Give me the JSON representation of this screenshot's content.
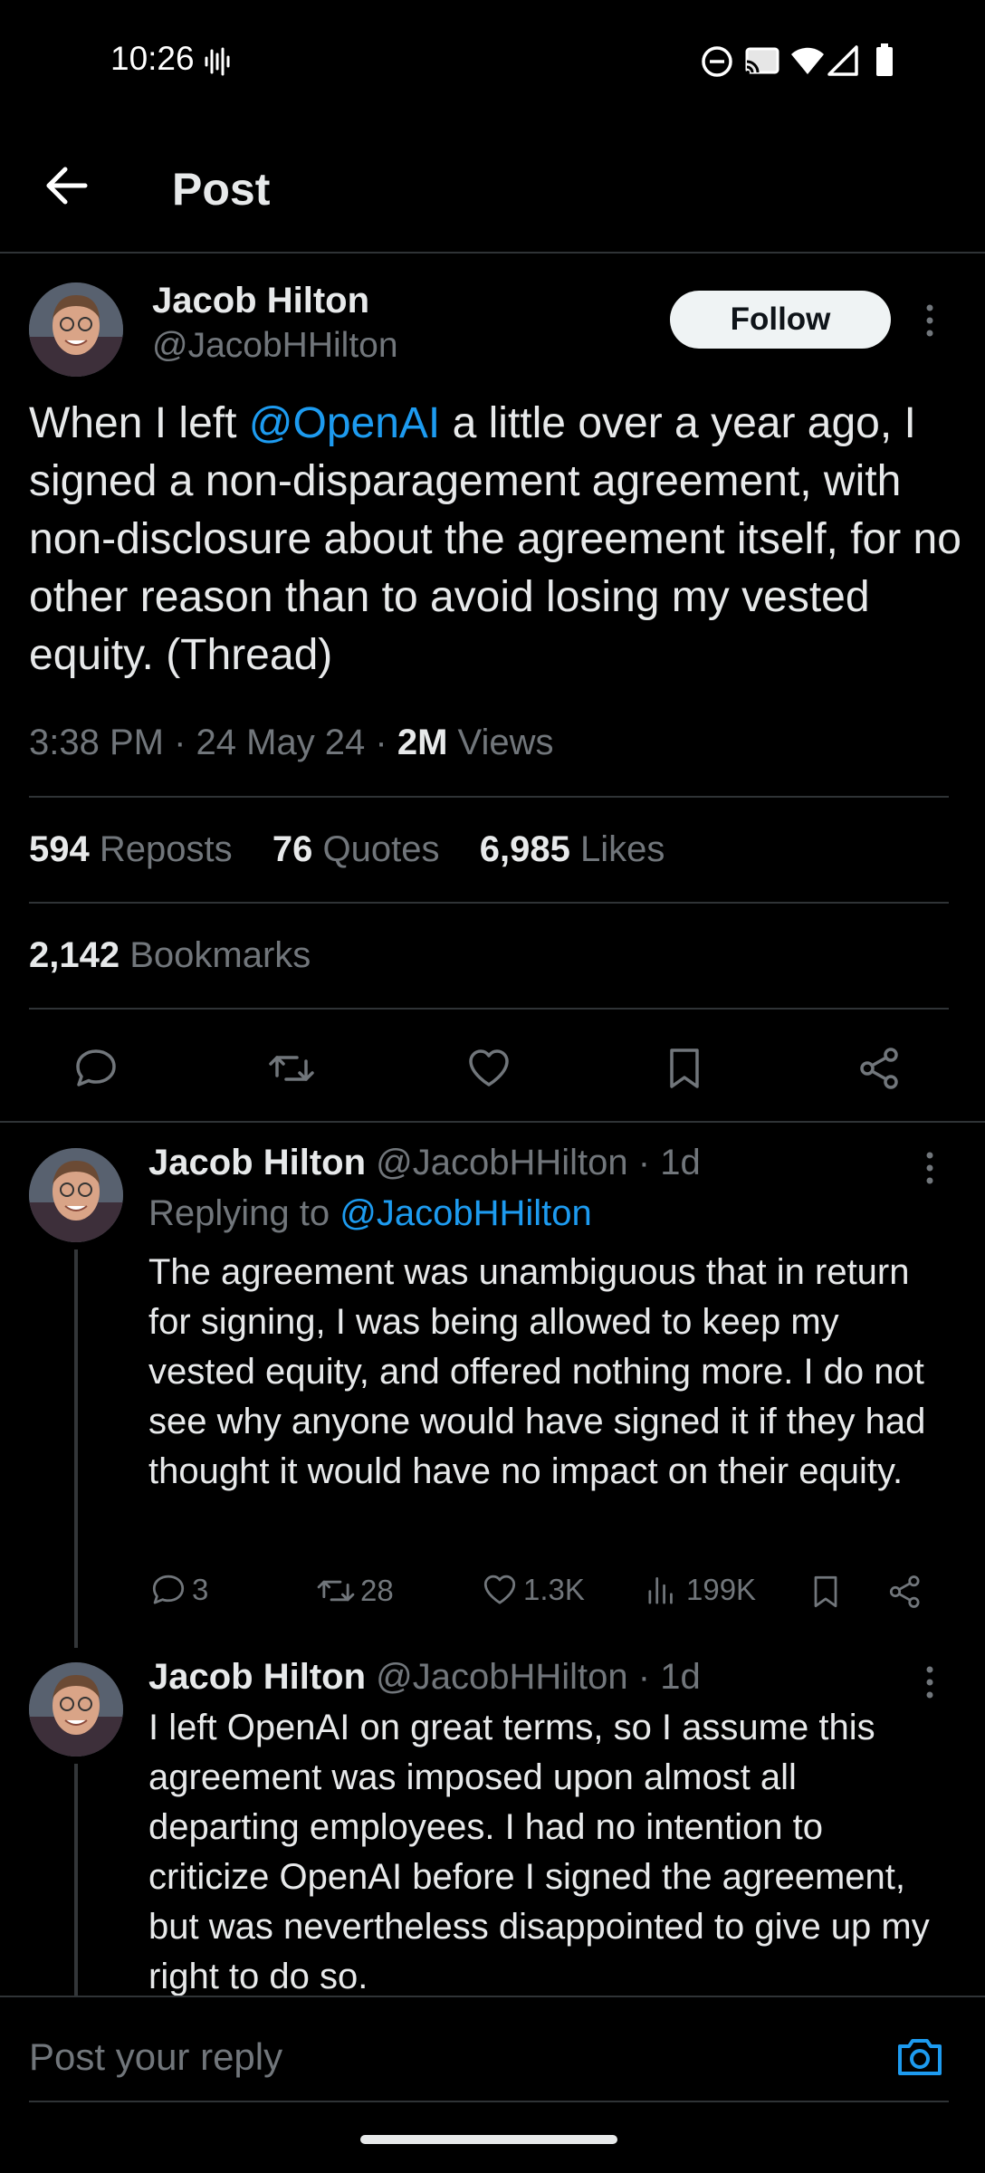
{
  "status_bar": {
    "time": "10:26"
  },
  "header": {
    "title": "Post"
  },
  "post": {
    "author_name": "Jacob Hilton",
    "author_handle": "@JacobHHilton",
    "follow_label": "Follow",
    "text_before": "When I left ",
    "mention": "@OpenAI",
    "text_after": " a little over a year ago, I signed a non-disparagement agreement, with non-disclosure about the agreement itself, for no other reason than to avoid losing my vested equity. (Thread)",
    "time": "3:38 PM",
    "date": "24 May 24",
    "views_count": "2M",
    "views_label": "Views",
    "reposts_count": "594",
    "reposts_label": "Reposts",
    "quotes_count": "76",
    "quotes_label": "Quotes",
    "likes_count": "6,985",
    "likes_label": "Likes",
    "bookmarks_count": "2,142",
    "bookmarks_label": "Bookmarks"
  },
  "replies": [
    {
      "author_name": "Jacob Hilton",
      "author_handle": "@JacobHHilton",
      "age": "1d",
      "replying_prefix": "Replying to",
      "replying_handle": "@JacobHHilton",
      "text": "The agreement was unambiguous that in return for signing, I was being allowed to keep my vested equity, and offered nothing more. I do not see why anyone would have signed it if they had thought it would have no impact on their equity.",
      "replies_count": "3",
      "reposts_count": "28",
      "likes_count": "1.3K",
      "views_count": "199K"
    },
    {
      "author_name": "Jacob Hilton",
      "author_handle": "@JacobHHilton",
      "age": "1d",
      "text": "I left OpenAI on great terms, so I assume this agreement was imposed upon almost all departing employees. I had no intention to criticize OpenAI before I signed the agreement, but was nevertheless disappointed to give up my right to do so."
    }
  ],
  "composer": {
    "placeholder": "Post your reply"
  },
  "colors": {
    "accent": "#1d9bf0",
    "background": "#000000",
    "text": "#e7e9ea",
    "secondary": "#71767b",
    "divider": "#2f3336"
  }
}
